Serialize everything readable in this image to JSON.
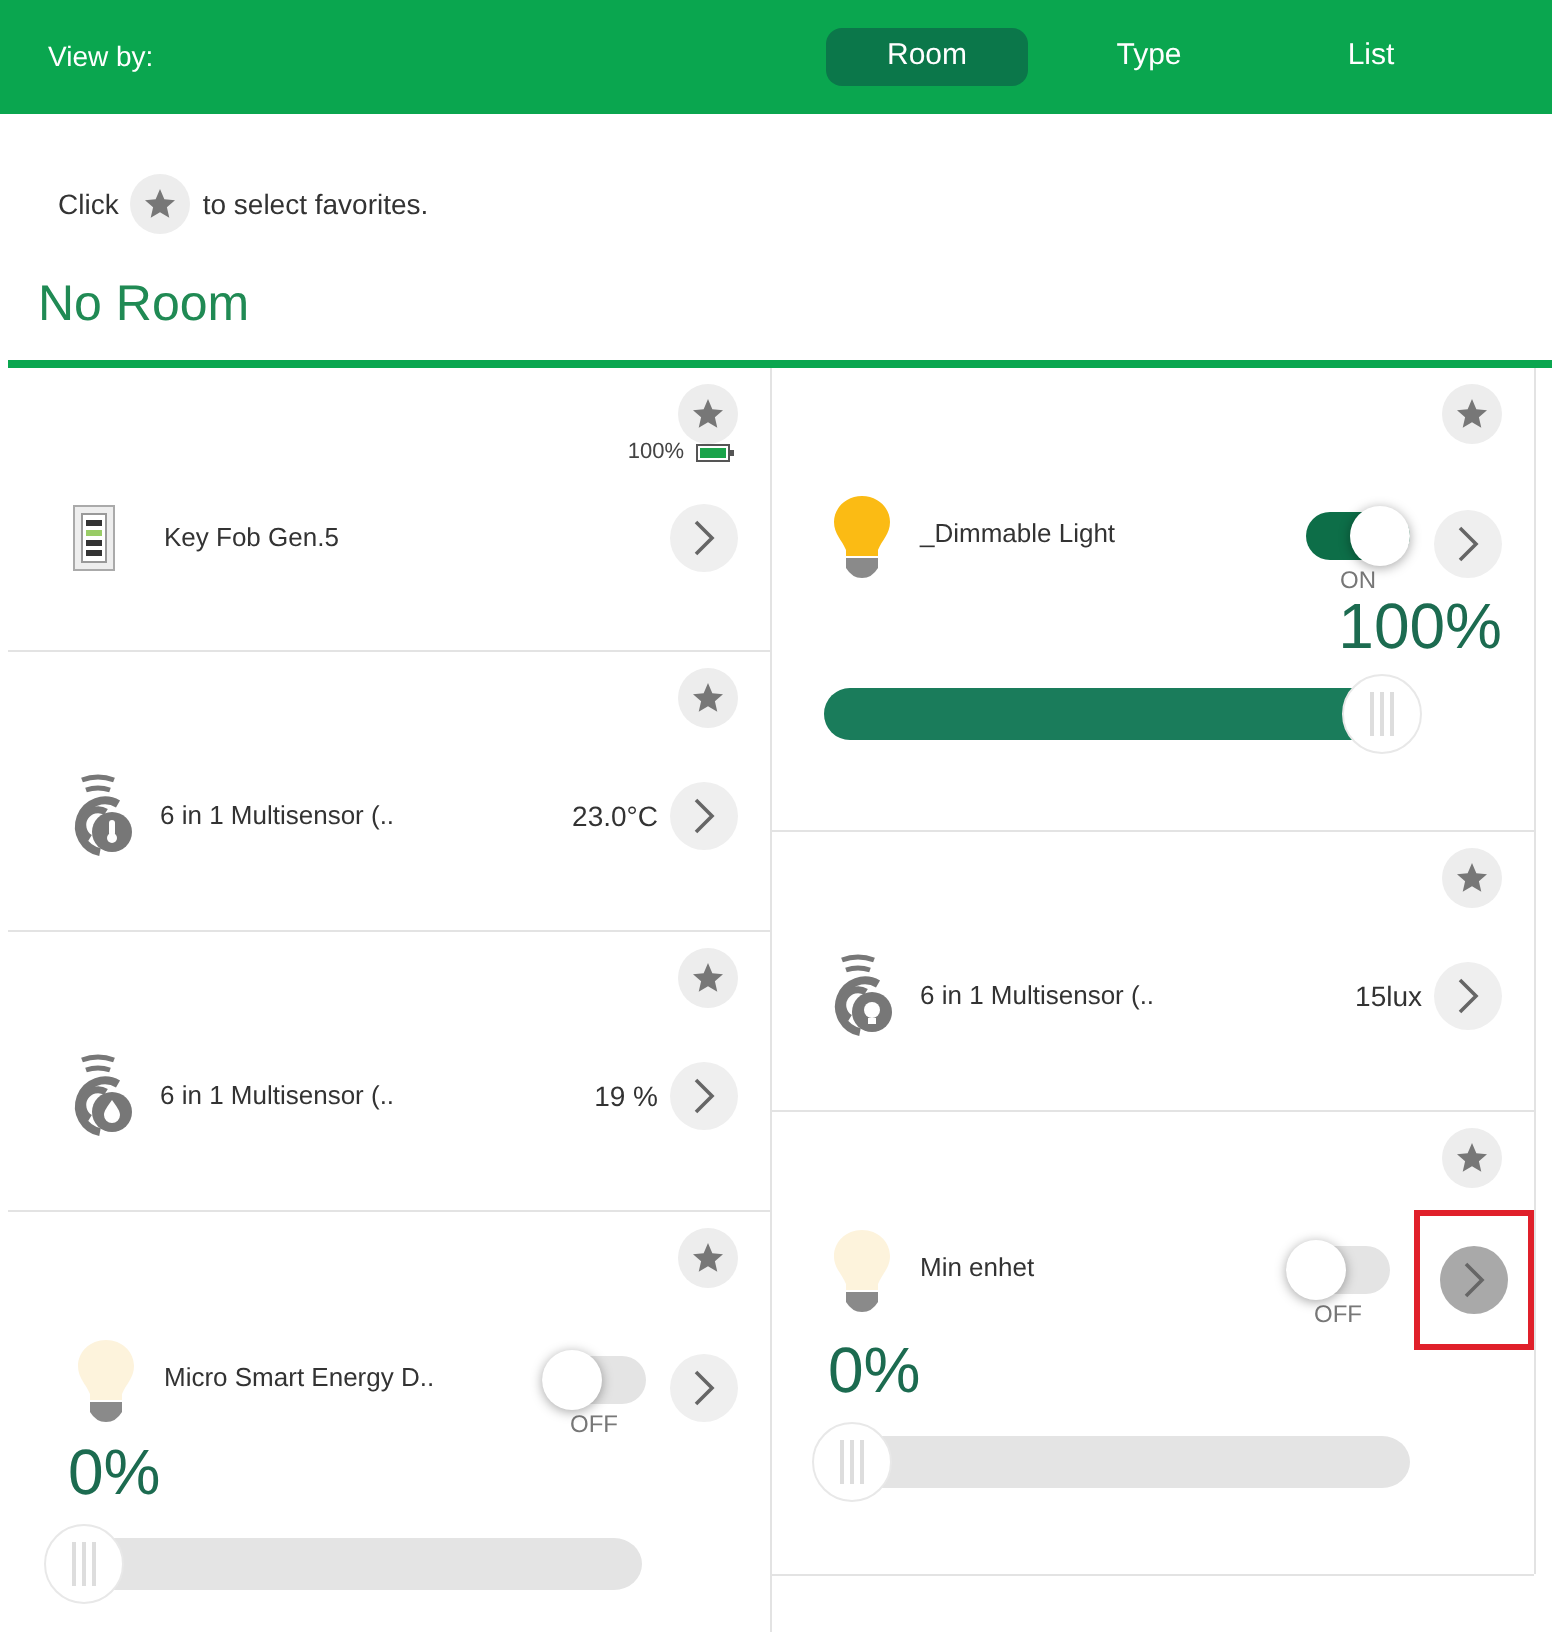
{
  "header": {
    "label": "View by:",
    "tabs": [
      {
        "label": "Room",
        "selected": true
      },
      {
        "label": "Type",
        "selected": false
      },
      {
        "label": "List",
        "selected": false
      }
    ]
  },
  "hint": {
    "before": "Click",
    "after": "to select favorites."
  },
  "section": {
    "title": "No Room"
  },
  "columns": [
    {
      "devices": [
        {
          "kind": "keyfob",
          "name": "Key Fob Gen.5",
          "battery": "100%"
        },
        {
          "kind": "temperature",
          "name": "6 in 1 Multisensor (..",
          "reading": "23.0°C"
        },
        {
          "kind": "humidity",
          "name": "6 in 1 Multisensor (..",
          "reading": "19 %"
        },
        {
          "kind": "dimmer",
          "name": "Micro Smart Energy D..",
          "on": false,
          "state": "OFF",
          "percent": "0%",
          "level": 0,
          "highlighted": false
        }
      ]
    },
    {
      "devices": [
        {
          "kind": "dimmer",
          "name": "_Dimmable Light",
          "on": true,
          "state": "ON",
          "percent": "100%",
          "level": 1,
          "highlighted": false
        },
        {
          "kind": "light",
          "name": "6 in 1 Multisensor (..",
          "reading": "15lux"
        },
        {
          "kind": "dimmer",
          "name": "Min enhet",
          "on": false,
          "state": "OFF",
          "percent": "0%",
          "level": 0,
          "highlighted": true
        }
      ]
    }
  ]
}
